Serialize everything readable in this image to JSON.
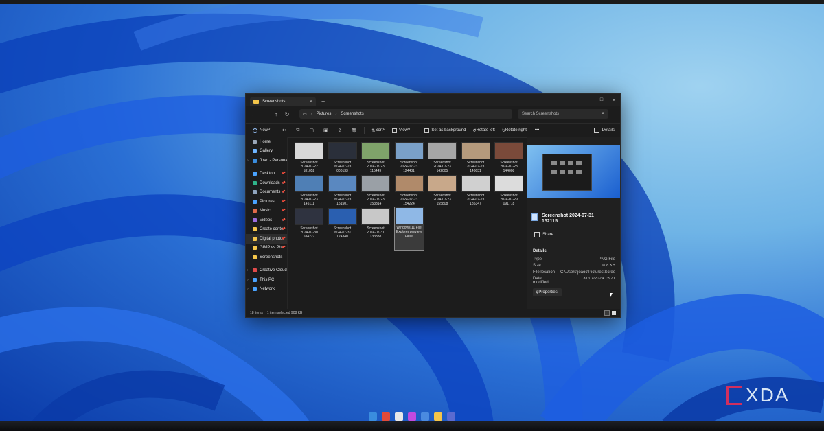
{
  "window": {
    "tab_title": "Screenshots",
    "tab_close": "×",
    "new_tab": "+",
    "controls": [
      "–",
      "□",
      "✕"
    ]
  },
  "address": {
    "nav": [
      "←",
      "→",
      "↑",
      "↻"
    ],
    "breadcrumb": [
      "Pictures",
      "Screenshots"
    ],
    "search_placeholder": "Search Screenshots"
  },
  "commands": {
    "new": "New",
    "sort": "Sort",
    "view": "View",
    "set_background": "Set as background",
    "rotate_left": "Rotate left",
    "rotate_right": "Rotate right",
    "more": "•••",
    "details": "Details"
  },
  "sidebar": {
    "items": [
      {
        "label": "Home",
        "color": "#9aa7b8"
      },
      {
        "label": "Gallery",
        "color": "#6fb5ff"
      },
      {
        "label": "Joao - Personal",
        "color": "#3a8dde"
      },
      {
        "label": "Desktop",
        "color": "#4aa3ff"
      },
      {
        "label": "Downloads",
        "color": "#2fb38a"
      },
      {
        "label": "Documents",
        "color": "#8fa4bd"
      },
      {
        "label": "Pictures",
        "color": "#4aa3ff"
      },
      {
        "label": "Music",
        "color": "#e06a4a"
      },
      {
        "label": "Videos",
        "color": "#9b6ee0"
      },
      {
        "label": "Create conte",
        "color": "#f4c54a"
      },
      {
        "label": "Digital photo",
        "color": "#f4c54a"
      },
      {
        "label": "GIMP vs Pho",
        "color": "#f4c54a"
      },
      {
        "label": "Screenshots",
        "color": "#f4c54a"
      },
      {
        "label": "Creative Cloud F",
        "color": "#e04a4a"
      },
      {
        "label": "This PC",
        "color": "#4aa3ff"
      },
      {
        "label": "Network",
        "color": "#4aa3ff"
      }
    ]
  },
  "files": [
    {
      "l1": "Screenshot",
      "l2": "2024-07-22",
      "l3": "181052",
      "color": "#d8d8d8"
    },
    {
      "l1": "Screenshot",
      "l2": "2024-07-23",
      "l3": "000133",
      "color": "#2a2f3a"
    },
    {
      "l1": "Screenshot",
      "l2": "2024-07-23",
      "l3": "115449",
      "color": "#7fa36a"
    },
    {
      "l1": "Screenshot",
      "l2": "2024-07-23",
      "l3": "124431",
      "color": "#7aa0c8"
    },
    {
      "l1": "Screenshot",
      "l2": "2024-07-23",
      "l3": "142005",
      "color": "#a6a6a6"
    },
    {
      "l1": "Screenshot",
      "l2": "2024-07-23",
      "l3": "143031",
      "color": "#b59a7c"
    },
    {
      "l1": "Screenshot",
      "l2": "2024-07-23",
      "l3": "144008",
      "color": "#7a4a3a"
    },
    {
      "l1": "Screenshot",
      "l2": "2024-07-23",
      "l3": "145111",
      "color": "#4f7fb5"
    },
    {
      "l1": "Screenshot",
      "l2": "2024-07-23",
      "l3": "151501",
      "color": "#5a88c0"
    },
    {
      "l1": "Screenshot",
      "l2": "2024-07-23",
      "l3": "153314",
      "color": "#9aa0a6"
    },
    {
      "l1": "Screenshot",
      "l2": "2024-07-23",
      "l3": "154224",
      "color": "#b08a6a"
    },
    {
      "l1": "Screenshot",
      "l2": "2024-07-23",
      "l3": "155808",
      "color": "#c8a88a"
    },
    {
      "l1": "Screenshot",
      "l2": "2024-07-23",
      "l3": "185347",
      "color": "#d0d0d0"
    },
    {
      "l1": "Screenshot",
      "l2": "2024-07-29",
      "l3": "091718",
      "color": "#dcdcdc"
    },
    {
      "l1": "Screenshot",
      "l2": "2024-07-30",
      "l3": "184227",
      "color": "#2f3340"
    },
    {
      "l1": "Screenshot",
      "l2": "2024-07-31",
      "l3": "124340",
      "color": "#2a5fb0"
    },
    {
      "l1": "Screenshot",
      "l2": "2024-07-31",
      "l3": "133338",
      "color": "#c8c8c8"
    },
    {
      "l1": "Windows 11 File",
      "l2": "Explorer preview",
      "l3": "pane",
      "color": "#8fb8e6"
    }
  ],
  "details": {
    "name": "Screenshot 2024-07-31 152115",
    "share": "Share",
    "section": "Details",
    "rows": [
      {
        "k": "Type",
        "v": "PNG File"
      },
      {
        "k": "Size",
        "v": "908 KB"
      },
      {
        "k": "File location",
        "v": "C:\\Users\\joaoc\\Pictures\\Scree..."
      },
      {
        "k": "Date modified",
        "v": "31/07/2024 15:21"
      }
    ],
    "properties": "Properties"
  },
  "status": {
    "items": "18 items",
    "selected": "1 item selected  908 KB"
  },
  "watermark": "XDA",
  "taskbar_colors": [
    "#3a8dde",
    "#e24a3a",
    "#e8e8e8",
    "#c04ae0",
    "#4a8ae0",
    "#f4c54a",
    "#5a6ad0"
  ]
}
